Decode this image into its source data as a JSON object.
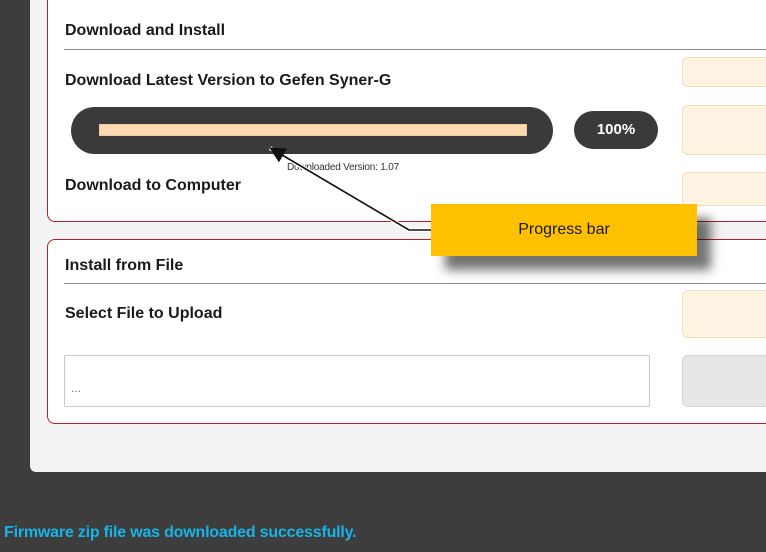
{
  "download_section": {
    "title": "Download and Install",
    "latest_label": "Download Latest Version to Gefen Syner-G",
    "progress": {
      "percent": 100,
      "label": "100%"
    },
    "downloaded_version": "Downloaded Version: 1.07",
    "computer_label": "Download to Computer"
  },
  "install_section": {
    "title": "Install from File",
    "select_label": "Select File to Upload",
    "file_input_value": "..."
  },
  "callout": {
    "text": "Progress bar",
    "color": "#ffc000"
  },
  "status": {
    "message": "Firmware zip file was downloaded successfully.",
    "color": "#18b4e8"
  },
  "colors": {
    "section_border": "#b4202a",
    "progress_fill": "#fbd9b3",
    "button_peach": "#fff3e3"
  }
}
